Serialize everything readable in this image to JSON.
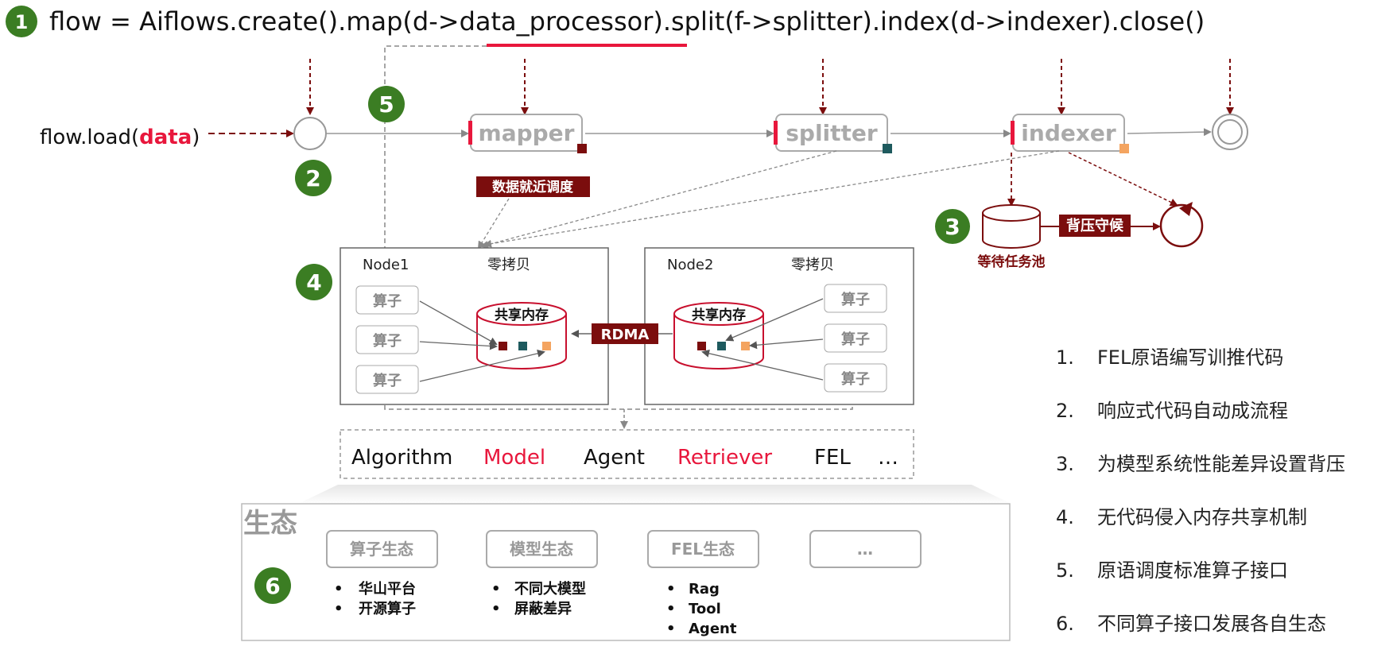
{
  "code_line": "flow = Aiflows.create().map(d->data_processor).split(f->splitter).index(d->indexer).close()",
  "steps": {
    "s1": "1",
    "s2": "2",
    "s3": "3",
    "s4": "4",
    "s5": "5",
    "s6": "6"
  },
  "load": {
    "prefix": "flow.load(",
    "arg": "data",
    "suffix": ")"
  },
  "operators": {
    "mapper": "mapper",
    "splitter": "splitter",
    "indexer": "indexer"
  },
  "scheduling_label": "数据就近调度",
  "backpressure": {
    "label": "背压守候",
    "pool": "等待任务池"
  },
  "nodes": [
    {
      "name": "Node1",
      "tag": "零拷贝",
      "ops": [
        "算子",
        "算子",
        "算子"
      ],
      "memory": "共享内存"
    },
    {
      "name": "Node2",
      "tag": "零拷贝",
      "ops": [
        "算子",
        "算子",
        "算子"
      ],
      "memory": "共享内存"
    }
  ],
  "rdma": "RDMA",
  "components": [
    {
      "label": "Algorithm",
      "color": "#111111"
    },
    {
      "label": "Model",
      "color": "#e8173c"
    },
    {
      "label": "Agent",
      "color": "#111111"
    },
    {
      "label": "Retriever",
      "color": "#e8173c"
    },
    {
      "label": "FEL",
      "color": "#111111"
    },
    {
      "label": "…",
      "color": "#111111"
    }
  ],
  "ecosystem": {
    "title": "生态",
    "groups": [
      {
        "label": "算子生态",
        "items": [
          "华山平台",
          "开源算子"
        ]
      },
      {
        "label": "模型生态",
        "items": [
          "不同大模型",
          "屏蔽差异"
        ]
      },
      {
        "label": "FEL生态",
        "items": [
          "Rag",
          "Tool",
          "Agent"
        ]
      },
      {
        "label": "…",
        "items": []
      }
    ]
  },
  "legend": [
    {
      "num": "1.",
      "text": "FEL原语编写训推代码"
    },
    {
      "num": "2.",
      "text": "响应式代码自动成流程"
    },
    {
      "num": "3.",
      "text": "为模型系统性能差异设置背压"
    },
    {
      "num": "4.",
      "text": "无代码侵入内存共享机制"
    },
    {
      "num": "5.",
      "text": "原语调度标准算子接口"
    },
    {
      "num": "6.",
      "text": "不同算子接口发展各自生态"
    }
  ],
  "colors": {
    "green": "#3b7d23",
    "darkred": "#7b0d0d",
    "red": "#e8173c",
    "teal": "#1e5a5e",
    "orange": "#f4a460",
    "gray": "#9a9a9a"
  }
}
